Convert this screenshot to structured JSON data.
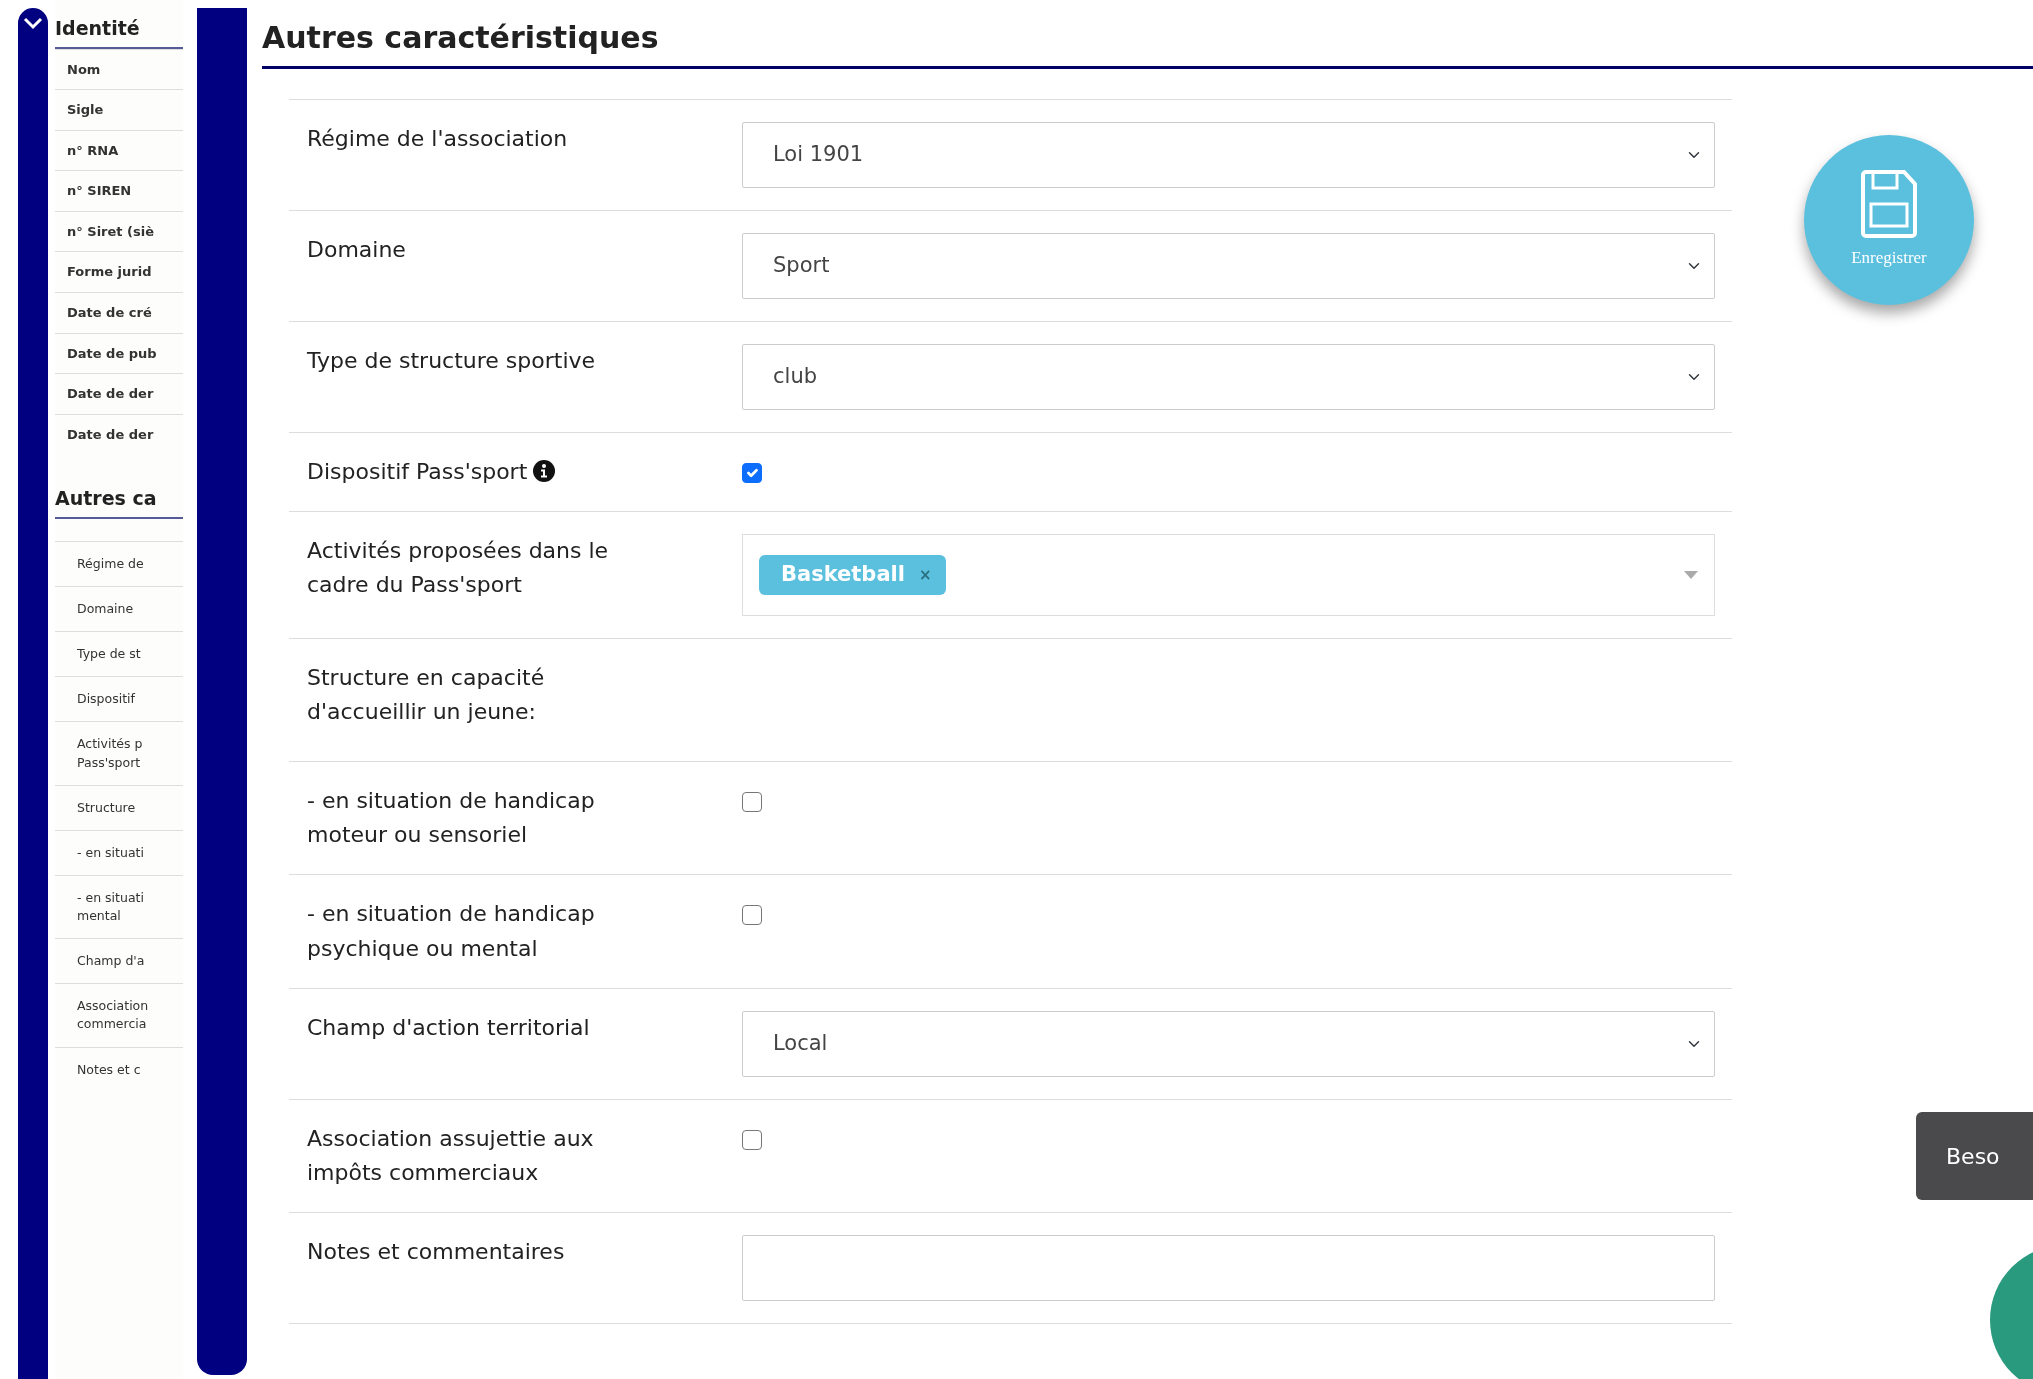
{
  "sidebar": {
    "identity": {
      "title": "Identité",
      "expanded": true,
      "items": [
        {
          "label": "Nom"
        },
        {
          "label": "Sigle"
        },
        {
          "label": "n° RNA"
        },
        {
          "label": "n° SIREN"
        },
        {
          "label": "n° Siret (siè"
        },
        {
          "label": "Forme jurid"
        },
        {
          "label": "Date de cré"
        },
        {
          "label": "Date de pub"
        },
        {
          "label": "Date de der"
        },
        {
          "label": "Date de der"
        }
      ]
    },
    "other": {
      "title": "Autres ca",
      "items": [
        {
          "label": "Régime de"
        },
        {
          "label": "Domaine"
        },
        {
          "label": "Type de st"
        },
        {
          "label": "Dispositif"
        },
        {
          "label": "Activités p Pass'sport"
        },
        {
          "label": "Structure"
        },
        {
          "label": "- en situati"
        },
        {
          "label": "- en situati mental"
        },
        {
          "label": "Champ d'a"
        },
        {
          "label": "Association commercia"
        },
        {
          "label": "Notes et c"
        }
      ]
    }
  },
  "form": {
    "title": "Autres caractéristiques",
    "rows": [
      {
        "kind": "select",
        "label": "Régime de l'association",
        "value": "Loi 1901"
      },
      {
        "kind": "select",
        "label": "Domaine",
        "value": "Sport"
      },
      {
        "kind": "select",
        "label": "Type de structure sportive",
        "value": "club"
      },
      {
        "kind": "checkbox",
        "label": "Dispositif Pass'sport",
        "info": true,
        "checked": true
      },
      {
        "kind": "tags",
        "label": "Activités proposées dans le cadre du Pass'sport",
        "tags": [
          {
            "label": "Basketball",
            "remove": "×"
          }
        ]
      },
      {
        "kind": "heading",
        "label": "Structure en capacité d'accueillir un jeune:"
      },
      {
        "kind": "checkbox",
        "label": "- en situation de handicap moteur ou sensoriel",
        "info": false,
        "checked": false
      },
      {
        "kind": "checkbox",
        "label": "- en situation de handicap psychique ou mental",
        "info": false,
        "checked": false
      },
      {
        "kind": "select",
        "label": "Champ d'action territorial",
        "value": "Local"
      },
      {
        "kind": "checkbox",
        "label": "Association assujettie aux impôts commerciaux",
        "info": false,
        "checked": false
      },
      {
        "kind": "text",
        "label": "Notes et commentaires"
      }
    ]
  },
  "save_button": {
    "label": "Enregistrer"
  },
  "help_tab": {
    "label": "Beso"
  }
}
